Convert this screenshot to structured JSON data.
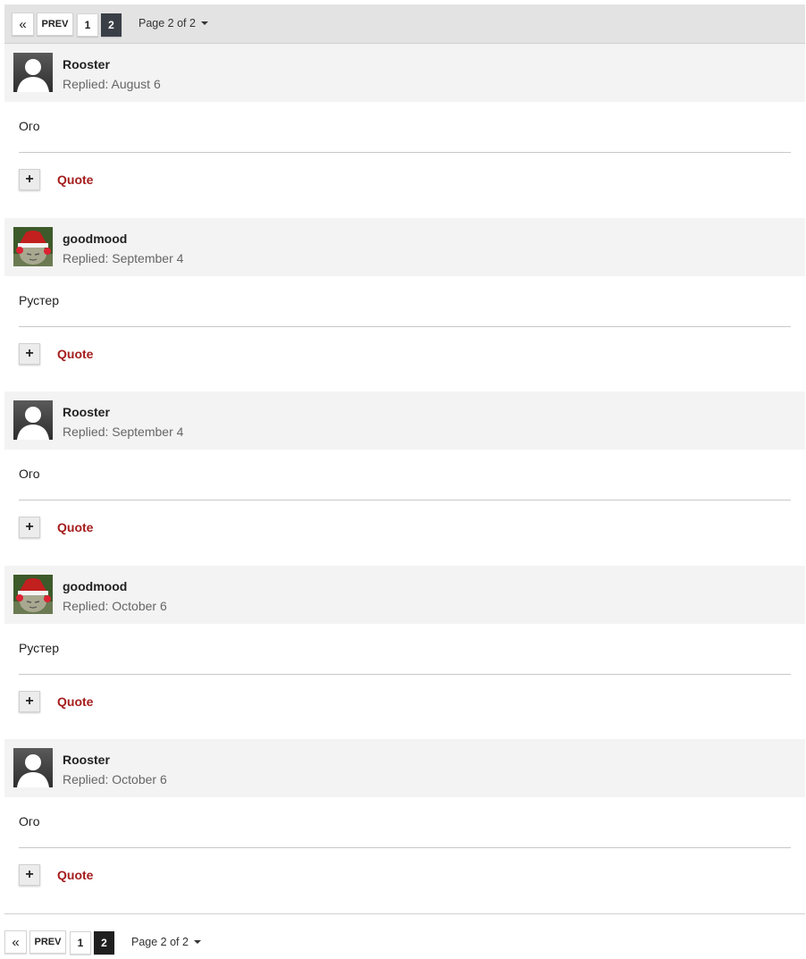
{
  "pagination": {
    "first_icon": "«",
    "prev_label": "PREV",
    "pages": [
      "1",
      "2"
    ],
    "current_page": "2",
    "page_label": "Page 2 of 2"
  },
  "posts": [
    {
      "author": "Rooster",
      "date": "Replied: August 6",
      "body": "Ого",
      "avatar": "default-user-avatar",
      "quote_label": "Quote",
      "plus_label": "+"
    },
    {
      "author": "goodmood",
      "date": "Replied: September 4",
      "body": "Рустер",
      "avatar": "cat-santa-hat-avatar",
      "quote_label": "Quote",
      "plus_label": "+"
    },
    {
      "author": "Rooster",
      "date": "Replied: September 4",
      "body": "Ого",
      "avatar": "default-user-avatar",
      "quote_label": "Quote",
      "plus_label": "+"
    },
    {
      "author": "goodmood",
      "date": "Replied: October 6",
      "body": "Рустер",
      "avatar": "cat-santa-hat-avatar",
      "quote_label": "Quote",
      "plus_label": "+"
    },
    {
      "author": "Rooster",
      "date": "Replied: October 6",
      "body": "Ого",
      "avatar": "default-user-avatar",
      "quote_label": "Quote",
      "plus_label": "+"
    }
  ],
  "colors": {
    "quote_link": "#a51d1d",
    "active_page_top": "#3a3f47",
    "active_page_bottom": "#1f1f1f",
    "header_bg": "#f3f3f3"
  }
}
